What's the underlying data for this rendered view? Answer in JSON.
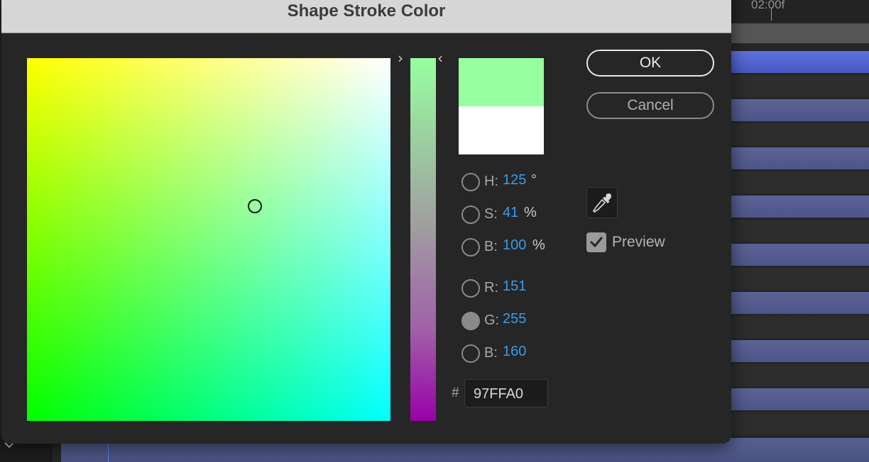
{
  "dialog": {
    "title": "Shape Stroke Color"
  },
  "timeline": {
    "ruler_label": "02:00f"
  },
  "color": {
    "new_swatch": "#97FFA0",
    "old_swatch": "#FFFFFF",
    "saturation_fraction": 0.41,
    "brightness_fraction": 1.0
  },
  "values": {
    "h": {
      "label": "H:",
      "value": "125",
      "unit": "°",
      "selected": false
    },
    "s": {
      "label": "S:",
      "value": "41",
      "unit": "%",
      "selected": false
    },
    "b_hsb": {
      "label": "B:",
      "value": "100",
      "unit": "%",
      "selected": false
    },
    "r": {
      "label": "R:",
      "value": "151",
      "selected": false
    },
    "g": {
      "label": "G:",
      "value": "255",
      "selected": true
    },
    "b_rgb": {
      "label": "B:",
      "value": "160",
      "selected": false
    }
  },
  "hex": {
    "prefix": "#",
    "value": "97FFA0"
  },
  "buttons": {
    "ok": "OK",
    "cancel": "Cancel"
  },
  "preview": {
    "label": "Preview",
    "checked": true
  },
  "icons": {
    "eyedropper": "eyedropper-icon",
    "checkmark": "checkmark-icon",
    "chevron_down": "chevron-down-icon"
  }
}
